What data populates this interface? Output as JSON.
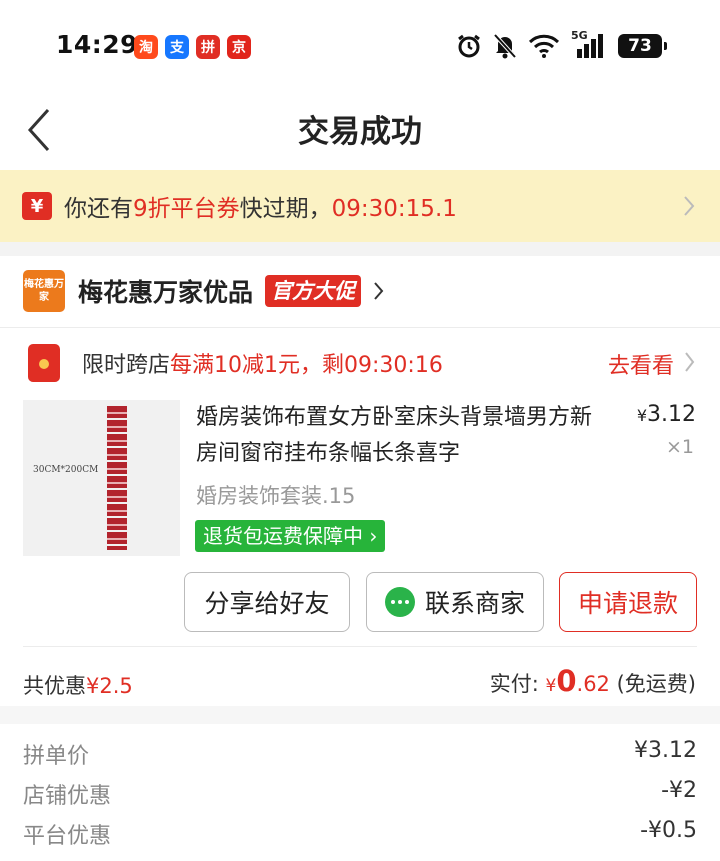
{
  "status_bar": {
    "time": "14:29",
    "apps": [
      {
        "icon": "taobao-app-icon",
        "glyph": "淘",
        "color": "#ff4a1c"
      },
      {
        "icon": "alipay-app-icon",
        "glyph": "支",
        "color": "#1677ff"
      },
      {
        "icon": "pinduoduo-app-icon",
        "glyph": "拼",
        "color": "#e02e24"
      },
      {
        "icon": "jd-app-icon",
        "glyph": "京",
        "color": "#e1251b"
      }
    ],
    "network": "5G",
    "battery": "73"
  },
  "nav": {
    "title": "交易成功"
  },
  "coupon_banner": {
    "icon_glyph": "¥",
    "text_prefix": "你还有",
    "coupon_name": "9折平台券",
    "text_suffix": "快过期，",
    "countdown": "09:30:15.1"
  },
  "store": {
    "logo_text": "梅花惠万家",
    "name": "梅花惠万家优品",
    "tag": "官方大促"
  },
  "promo": {
    "label": "限时跨店",
    "deal": "每满10减1元，剩09:30:16",
    "link": "去看看"
  },
  "product": {
    "thumb_caption": "30CM*200CM",
    "title": "婚房装饰布置女方卧室床头背景墙男方新房间窗帘挂布条幅长条喜字",
    "price_symbol": "¥",
    "price": "3.12",
    "quantity": "×1",
    "spec": "婚房装饰套装.15",
    "guarantee": "退货包运费保障中"
  },
  "actions": {
    "share_label": "分享给好友",
    "contact_label": "联系商家",
    "refund_label": "申请退款"
  },
  "summary": {
    "discount_label": "共优惠",
    "discount_value": "¥2.5",
    "paid_label": "实付:",
    "paid_symbol": "¥",
    "paid_integer": "0",
    "paid_decimal": ".62",
    "shipping_note": "(免运费)"
  },
  "details": [
    {
      "label": "拼单价",
      "value": "¥3.12"
    },
    {
      "label": "店铺优惠",
      "value": "-¥2"
    },
    {
      "label": "平台优惠",
      "value": "-¥0.5"
    }
  ],
  "colors": {
    "accent_red": "#e02e24",
    "banner_bg": "#fbf2c4",
    "guarantee_green": "#27b43a"
  }
}
